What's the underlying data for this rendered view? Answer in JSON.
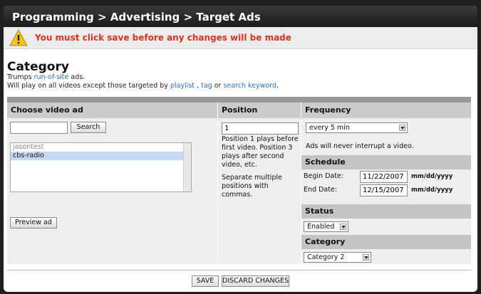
{
  "header": {
    "breadcrumb": "Programming > Advertising > Target Ads"
  },
  "warning": {
    "message": "You must click save before any changes will be made"
  },
  "page": {
    "heading": "Category",
    "desc_line1_prefix": "Trumps ",
    "desc_line1_link": "run-of-site",
    "desc_line1_suffix": " ads.",
    "desc_line2_prefix": "Will play on all videos except those targeted by ",
    "desc_link_playlist": "playlist",
    "desc_sep1": " , ",
    "desc_link_tag": "tag",
    "desc_sep2": " or ",
    "desc_link_keyword": "search keyword",
    "desc_end": "."
  },
  "video_ad": {
    "header": "Choose video ad",
    "search_value": "",
    "search_button": "Search",
    "items": [
      {
        "label": "jasontest",
        "state": "dim"
      },
      {
        "label": "cbs-radio",
        "state": "selected"
      }
    ],
    "preview_button": "Preview ad"
  },
  "position": {
    "header": "Position",
    "value": "1",
    "help": "Position 1 plays before first video. Position 3 plays after second video, etc.",
    "help2": "Separate multiple positions with commas."
  },
  "frequency": {
    "header": "Frequency",
    "selected": "every 5 min",
    "note": "Ads will never interrupt a video."
  },
  "schedule": {
    "header": "Schedule",
    "begin_label": "Begin Date:",
    "begin_value": "11/22/2007",
    "end_label": "End Date:",
    "end_value": "12/15/2007",
    "format_hint": "mm/dd/yyyy"
  },
  "status": {
    "header": "Status",
    "selected": "Enabled"
  },
  "category": {
    "header": "Category",
    "selected": "Category 2"
  },
  "footer": {
    "save_label": "SAVE",
    "discard_label": "DISCARD CHANGES"
  },
  "colors": {
    "warning_text": "#e0301e",
    "link": "#2c6ec0",
    "selection": "#c7d8f3"
  }
}
